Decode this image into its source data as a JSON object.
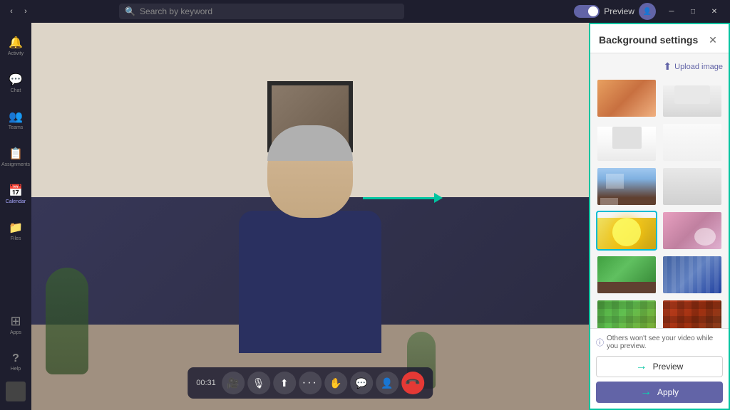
{
  "titlebar": {
    "back_btn": "‹",
    "forward_btn": "›",
    "search_placeholder": "Search by keyword",
    "preview_label": "Preview",
    "toggle_on": true,
    "win_min": "─",
    "win_restore": "□",
    "win_close": "✕"
  },
  "sidebar": {
    "items": [
      {
        "id": "activity",
        "icon": "🔔",
        "label": "Activity"
      },
      {
        "id": "chat",
        "icon": "💬",
        "label": "Chat"
      },
      {
        "id": "teams",
        "icon": "👥",
        "label": "Teams"
      },
      {
        "id": "assignments",
        "icon": "📋",
        "label": "Assignments"
      },
      {
        "id": "calendar",
        "icon": "📅",
        "label": "Calendar"
      },
      {
        "id": "files",
        "icon": "📁",
        "label": "Files"
      },
      {
        "id": "apps",
        "icon": "⋯",
        "label": "Apps"
      },
      {
        "id": "help",
        "icon": "?",
        "label": "Help"
      }
    ],
    "active": "calendar"
  },
  "controls": {
    "timer": "00:31",
    "buttons": [
      {
        "id": "camera",
        "icon": "🎥",
        "label": "Camera"
      },
      {
        "id": "mic",
        "icon": "🎤",
        "label": "Microphone"
      },
      {
        "id": "share",
        "icon": "⬆",
        "label": "Share screen"
      },
      {
        "id": "more",
        "icon": "•••",
        "label": "More options"
      },
      {
        "id": "raise",
        "icon": "✋",
        "label": "Raise hand"
      },
      {
        "id": "chat-ctrl",
        "icon": "💬",
        "label": "Chat"
      },
      {
        "id": "participants",
        "icon": "👤",
        "label": "Participants"
      },
      {
        "id": "hang-up",
        "icon": "📞",
        "label": "Hang up",
        "variant": "red"
      }
    ]
  },
  "bg_settings": {
    "title": "Background settings",
    "close_label": "✕",
    "upload_label": "Upload image",
    "thumbnails": [
      {
        "id": "orange-sunset",
        "color": "bg-orange",
        "selected": false
      },
      {
        "id": "white-room",
        "color": "bg-white-room",
        "selected": false
      },
      {
        "id": "bright-room",
        "color": "bg-bright-room",
        "selected": false
      },
      {
        "id": "white-minimal",
        "color": "bg-white-minimal",
        "selected": false
      },
      {
        "id": "office-window",
        "color": "bg-office-window",
        "selected": false
      },
      {
        "id": "empty-gray",
        "color": "bg-empty",
        "selected": false
      },
      {
        "id": "yellow-abstract",
        "color": "bg-yellow-abstract",
        "selected": true
      },
      {
        "id": "pink-rocks",
        "color": "bg-pink-rocks",
        "selected": false
      },
      {
        "id": "garden",
        "color": "bg-garden",
        "selected": false
      },
      {
        "id": "library",
        "color": "bg-library",
        "selected": false
      },
      {
        "id": "minecraft-green",
        "color": "bg-minecraft-1",
        "selected": false
      },
      {
        "id": "minecraft-dark",
        "color": "bg-minecraft-2",
        "selected": false
      }
    ],
    "note": "Others won't see your video while you preview.",
    "preview_btn": "Preview",
    "apply_btn": "Apply"
  }
}
